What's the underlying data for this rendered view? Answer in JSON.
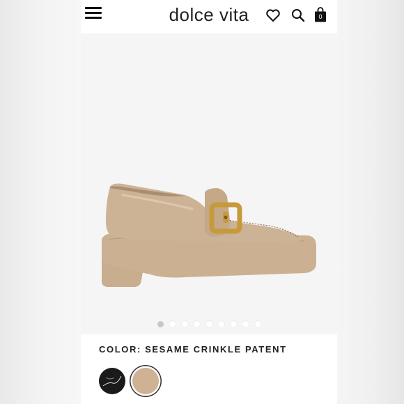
{
  "header": {
    "logo": "dolce vita",
    "icons": [
      "menu-icon",
      "heart-icon",
      "search-icon",
      "bag-icon"
    ],
    "bag_count": "0"
  },
  "product": {
    "image": "beige crinkle patent platform loafer with gold buckle",
    "color_label": "COLOR: SESAME CRINKLE PATENT",
    "carousel": {
      "total": 9,
      "active": 1
    },
    "swatches": [
      {
        "name": "black",
        "color": "#1a1a1a",
        "selected": false
      },
      {
        "name": "sesame",
        "color": "#cfb193",
        "selected": true
      }
    ]
  },
  "colors": {
    "page_bg": "#f5f5f5",
    "shoe": "#cdb395",
    "buckle": "#c69a3a"
  }
}
